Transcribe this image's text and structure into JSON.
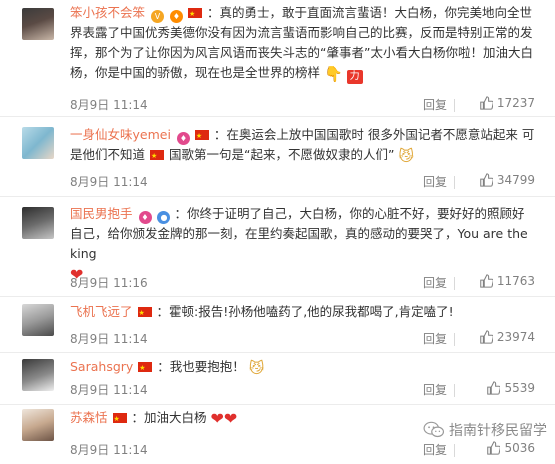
{
  "comments": [
    {
      "username": "笨小孩不会笨",
      "text": "：真的勇士，敢于直面流言蜚语！大白杨，你完美地向全世界表露了中国优秀美德你没有因为流言蜚语而影响自己的比赛，反而是特别正常的发挥，那个为了让你因为风言风语而丧失斗志的“肇事者”太小看大白杨你啦！加油大白杨，你是中国的骄傲，现在也是全世界的榜样",
      "time": "8月9日 11:14",
      "reply": "回复",
      "likes": "17237"
    },
    {
      "username": "一身仙女味yemei",
      "text": "：在奥运会上放中国国歌时 很多外国记者不愿意站起来 可是他们不知道",
      "text2": "国歌第一句是“起来，不愿做奴隶的人们”",
      "time": "8月9日 11:14",
      "reply": "回复",
      "likes": "34799"
    },
    {
      "username": "国民男抱手",
      "text": "：你终于证明了自己，大白杨，你的心脏不好，要好好的照顾好自己，给你颁发金牌的那一刻，在里约奏起国歌，真的感动的要哭了，You are the king",
      "time": "8月9日 11:16",
      "reply": "回复",
      "likes": "11763"
    },
    {
      "username": "飞机飞远了",
      "text": "：霍顿:报告!孙杨他嗑药了,他的尿我都喝了,肯定嗑了!",
      "time": "8月9日 11:14",
      "reply": "回复",
      "likes": "23974"
    },
    {
      "username": "Sarahsgry",
      "text": "：我也要抱抱！",
      "time": "8月9日 11:14",
      "reply": "回复",
      "likes": "5539"
    },
    {
      "username": "苏森恬",
      "text": "：加油大白杨",
      "time": "8月9日 11:14",
      "reply": "回复",
      "likes": "5036"
    }
  ],
  "watermark": "指南针移民留学",
  "colors": {
    "username": "#eb7350",
    "text": "#333333",
    "meta": "#808080",
    "flag": "#de2910",
    "heart": "#e0302d"
  },
  "icons": [
    "thumb-up-icon",
    "china-flag-icon",
    "doge-emoji-icon",
    "heart-emoji-icon",
    "wechat-logo-icon"
  ]
}
